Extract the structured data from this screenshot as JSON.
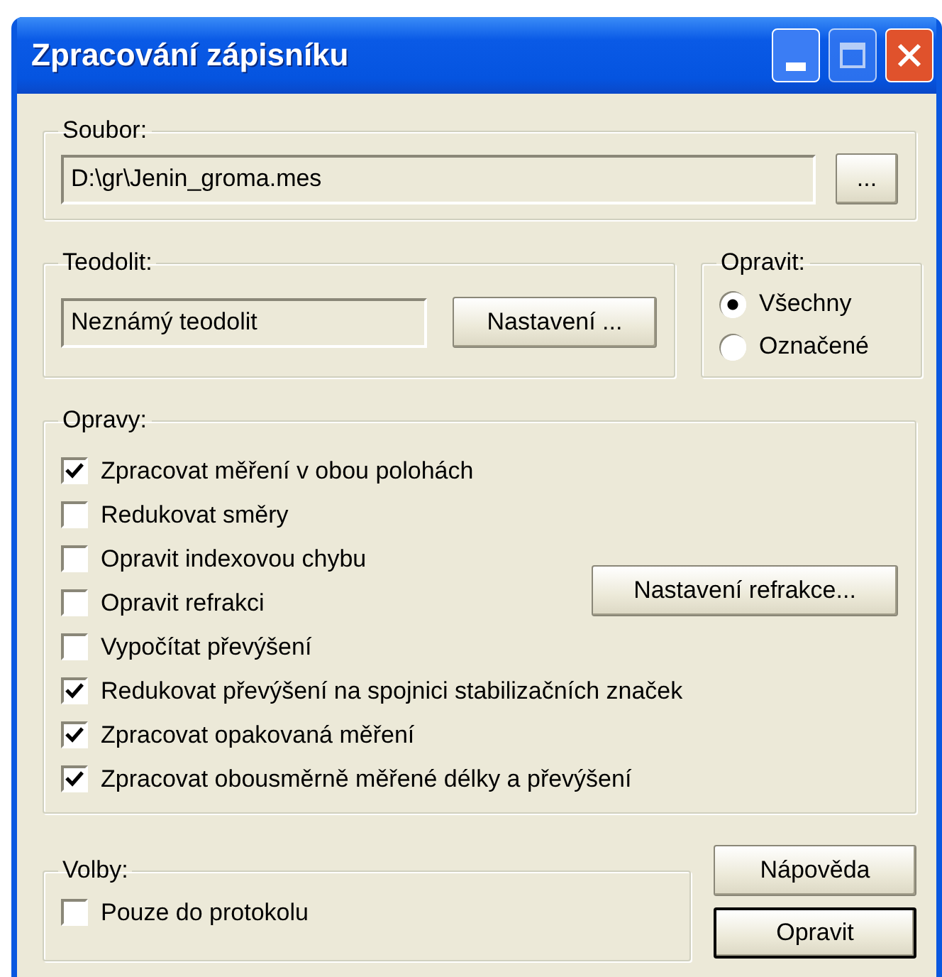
{
  "window": {
    "title": "Zpracování zápisníku"
  },
  "file_group": {
    "label": "Soubor:",
    "value": "D:\\gr\\Jenin_groma.mes",
    "browse_button": "..."
  },
  "theodolite_group": {
    "label": "Teodolit:",
    "value": "Neznámý teodolit",
    "settings_button": "Nastavení ..."
  },
  "correct_group": {
    "label": "Opravit:",
    "options": [
      {
        "label": "Všechny",
        "selected": true
      },
      {
        "label": "Označené",
        "selected": false
      }
    ]
  },
  "corrections_group": {
    "label": "Opravy:",
    "refraction_button": "Nastavení refrakce...",
    "options": [
      {
        "label": "Zpracovat měření v obou polohách",
        "checked": true
      },
      {
        "label": "Redukovat směry",
        "checked": false
      },
      {
        "label": "Opravit indexovou chybu",
        "checked": false
      },
      {
        "label": "Opravit refrakci",
        "checked": false
      },
      {
        "label": "Vypočítat převýšení",
        "checked": false
      },
      {
        "label": "Redukovat převýšení na spojnici stabilizačních značek",
        "checked": true
      },
      {
        "label": "Zpracovat opakovaná měření",
        "checked": true
      },
      {
        "label": "Zpracovat obousměrně měřené délky a převýšení",
        "checked": true
      }
    ]
  },
  "options_group": {
    "label": "Volby:",
    "options": [
      {
        "label": "Pouze do protokolu",
        "checked": false
      }
    ]
  },
  "buttons": [
    {
      "label": "Nápověda",
      "default": false
    },
    {
      "label": "Opravit",
      "default": true
    }
  ]
}
